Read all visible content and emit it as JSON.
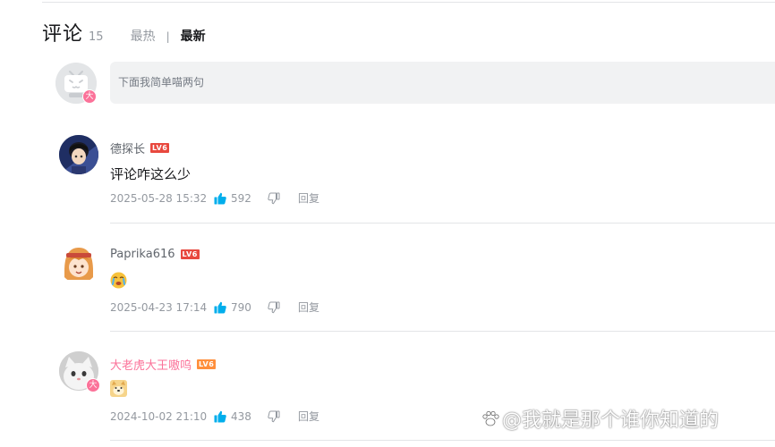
{
  "header": {
    "title": "评论",
    "count": "15",
    "sort_hot": "最热",
    "sort_sep": "|",
    "sort_new": "最新"
  },
  "input": {
    "placeholder": "下面我简单喵两句",
    "user_badge": "大"
  },
  "comments": [
    {
      "user": "德探长",
      "level": "LV6",
      "text": "评论咋这么少",
      "time": "2025-05-28 15:32",
      "likes": "592",
      "reply": "回复"
    },
    {
      "user": "Paprika616",
      "level": "LV6",
      "text": "",
      "emoji": "crying-face-emoji",
      "time": "2025-04-23 17:14",
      "likes": "790",
      "reply": "回复"
    },
    {
      "user": "大老虎大王嗷呜",
      "level": "LV6",
      "badge": "大",
      "text": "",
      "emoji": "doge-emoji",
      "time": "2024-10-02 21:10",
      "likes": "438",
      "reply": "回复"
    }
  ],
  "watermark": "@我就是那个谁你知道的",
  "colors": {
    "vip_pink": "#fb7299",
    "like_blue": "#00aeec",
    "level_red": "#e8483e",
    "input_bg": "#f1f2f3"
  }
}
